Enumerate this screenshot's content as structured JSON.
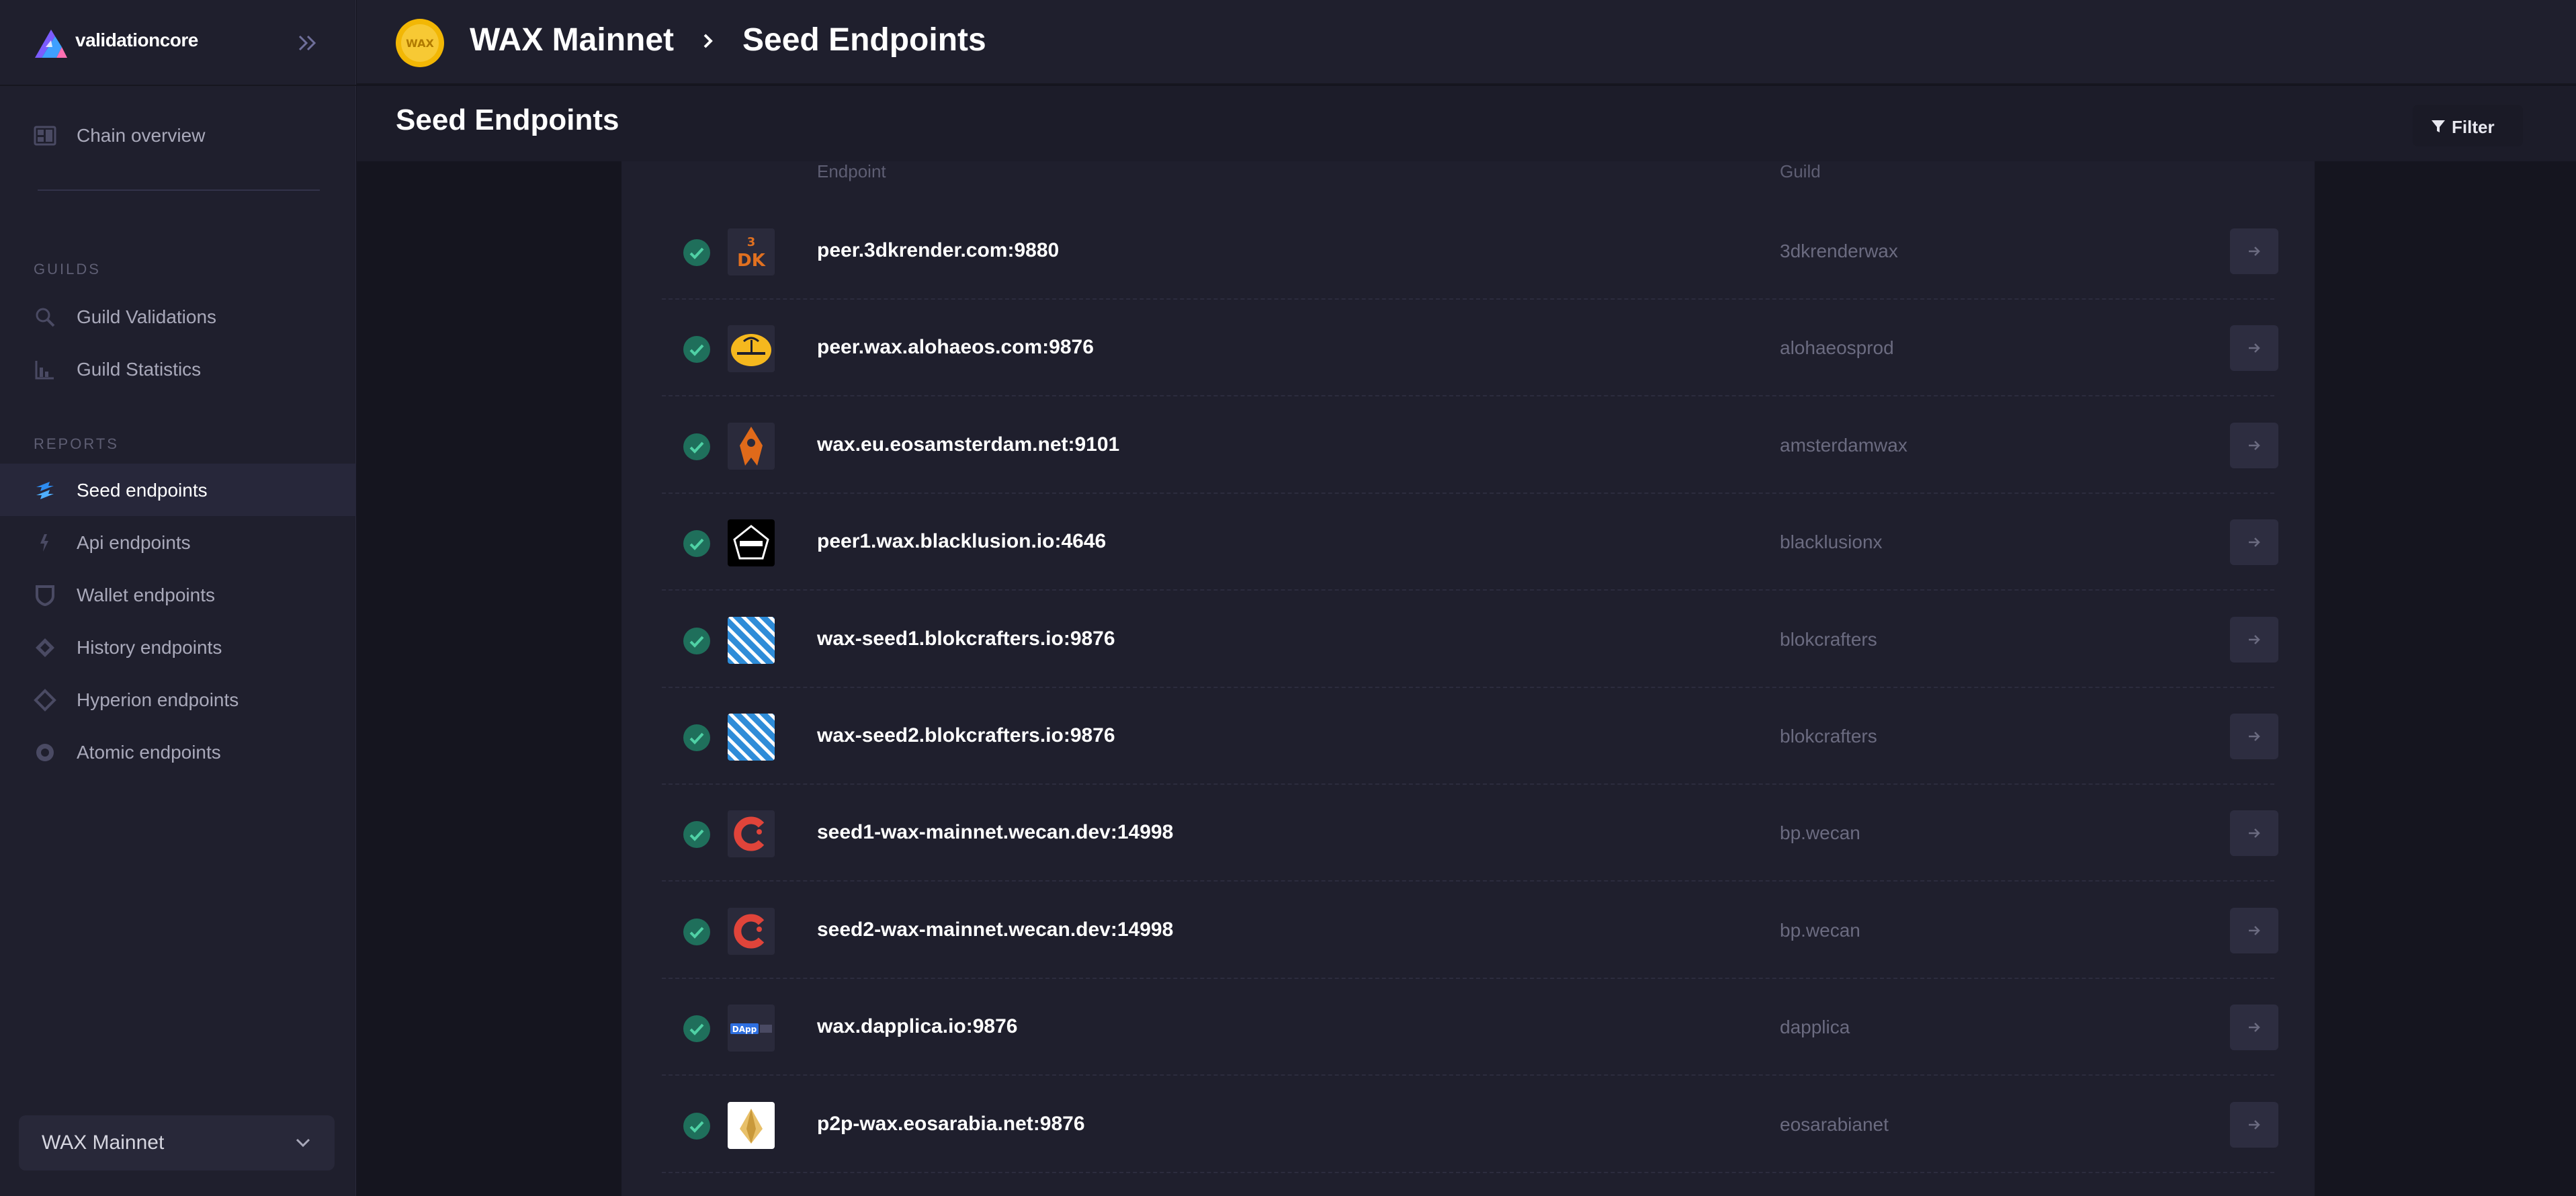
{
  "brand": {
    "name": "validationcore"
  },
  "sidebar": {
    "top_item": {
      "label": "Chain overview"
    },
    "guilds_label": "GUILDS",
    "guild_items": [
      {
        "label": "Guild Validations",
        "icon": "search-chart-icon"
      },
      {
        "label": "Guild Statistics",
        "icon": "bar-chart-icon"
      }
    ],
    "reports_label": "REPORTS",
    "report_items": [
      {
        "label": "Seed endpoints",
        "icon": "seed-arrows-icon",
        "active": true
      },
      {
        "label": "Api endpoints",
        "icon": "api-bolt-icon",
        "active": false
      },
      {
        "label": "Wallet endpoints",
        "icon": "shield-icon",
        "active": false
      },
      {
        "label": "History endpoints",
        "icon": "diamond-icon",
        "active": false
      },
      {
        "label": "Hyperion endpoints",
        "icon": "diamond-outline-icon",
        "active": false
      },
      {
        "label": "Atomic endpoints",
        "icon": "circle-icon",
        "active": false
      }
    ],
    "chain_selector": {
      "value": "WAX Mainnet"
    }
  },
  "topbar": {
    "chain_name": "WAX Mainnet",
    "page_name": "Seed Endpoints"
  },
  "page": {
    "title": "Seed Endpoints",
    "filter_label": "Filter"
  },
  "table": {
    "columns": {
      "endpoint": "Endpoint",
      "guild": "Guild"
    },
    "rows": [
      {
        "endpoint": "peer.3dkrender.com:9880",
        "guild": "3dkrenderwax",
        "logo": "3dk"
      },
      {
        "endpoint": "peer.wax.alohaeos.com:9876",
        "guild": "alohaeosprod",
        "logo": "aloha"
      },
      {
        "endpoint": "wax.eu.eosamsterdam.net:9101",
        "guild": "amsterdamwax",
        "logo": "amsterdam"
      },
      {
        "endpoint": "peer1.wax.blacklusion.io:4646",
        "guild": "blacklusionx",
        "logo": "blacklusion"
      },
      {
        "endpoint": "wax-seed1.blokcrafters.io:9876",
        "guild": "blokcrafters",
        "logo": "blokcrafters"
      },
      {
        "endpoint": "wax-seed2.blokcrafters.io:9876",
        "guild": "blokcrafters",
        "logo": "blokcrafters"
      },
      {
        "endpoint": "seed1-wax-mainnet.wecan.dev:14998",
        "guild": "bp.wecan",
        "logo": "wecan"
      },
      {
        "endpoint": "seed2-wax-mainnet.wecan.dev:14998",
        "guild": "bp.wecan",
        "logo": "wecan"
      },
      {
        "endpoint": "wax.dapplica.io:9876",
        "guild": "dapplica",
        "logo": "dapplica"
      },
      {
        "endpoint": "p2p-wax.eosarabia.net:9876",
        "guild": "eosarabianet",
        "logo": "eosarabia"
      }
    ]
  },
  "colors": {
    "background": "#15151f",
    "panel": "#1f1f2d",
    "check_green": "#1f6f5b",
    "check_mark": "#4fd1a5",
    "muted_text": "#6b6b80",
    "accent_blue": "#2e8cf0"
  }
}
